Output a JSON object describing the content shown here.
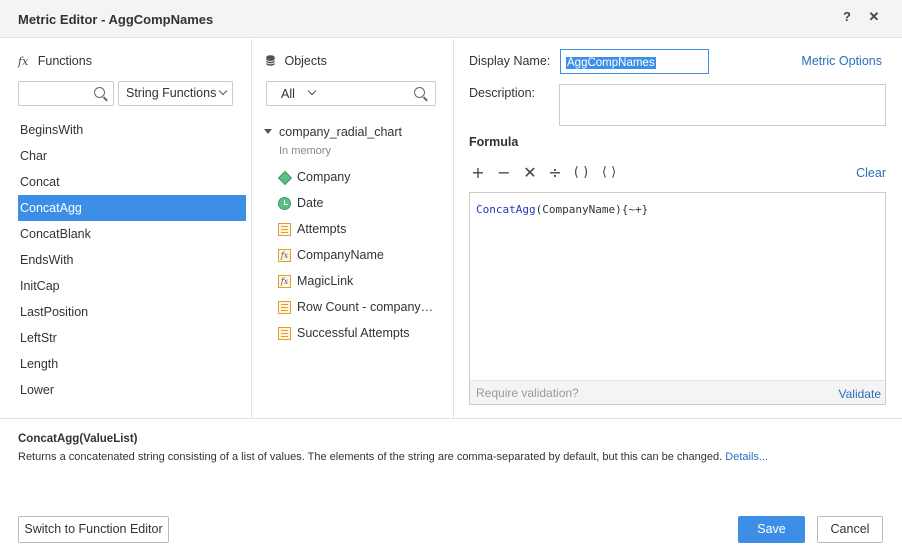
{
  "window": {
    "title": "Metric Editor - AggCompNames",
    "help_label": "?",
    "close_label": "✕"
  },
  "functions_panel": {
    "header": "Functions",
    "header_icon": "fx",
    "search_placeholder": "",
    "category": "String Functions",
    "items": [
      "BeginsWith",
      "Char",
      "Concat",
      "ConcatAgg",
      "ConcatBlank",
      "EndsWith",
      "InitCap",
      "LastPosition",
      "LeftStr",
      "Length",
      "Lower"
    ],
    "selected_index": 3
  },
  "objects_panel": {
    "header": "Objects",
    "filter": "All",
    "root": "company_radial_chart",
    "root_sub": "In memory",
    "items": [
      {
        "label": "Company",
        "icon": "attribute-icon"
      },
      {
        "label": "Date",
        "icon": "date-attribute-icon"
      },
      {
        "label": "Attempts",
        "icon": "measure-icon"
      },
      {
        "label": "CompanyName",
        "icon": "formula-icon"
      },
      {
        "label": "MagicLink",
        "icon": "formula-icon"
      },
      {
        "label": "Row Count - company…",
        "icon": "measure-icon"
      },
      {
        "label": "Successful Attempts",
        "icon": "measure-icon"
      }
    ]
  },
  "editor": {
    "display_name_label": "Display Name:",
    "display_name_value": "AggCompNames",
    "description_label": "Description:",
    "metric_options": "Metric Options",
    "formula_label": "Formula",
    "operators": [
      "+",
      "−",
      "✕",
      "÷",
      "( )",
      "⟨ ⟩"
    ],
    "clear": "Clear",
    "formula_fn": "ConcatAgg",
    "formula_rest": "(CompanyName){~+}",
    "require_validation": "Require validation?",
    "validate": "Validate"
  },
  "help": {
    "signature": "ConcatAgg(ValueList)",
    "description": "Returns a concatenated string consisting of a list of values. The elements of the string are comma-separated by default, but this can be changed.",
    "details": "Details..."
  },
  "footer": {
    "switch": "Switch to Function Editor",
    "save": "Save",
    "cancel": "Cancel"
  },
  "colors": {
    "accent": "#3d8ee6",
    "link": "#2a6fbd",
    "attribute_green": "#5cbf86",
    "measure_orange": "#e0a030"
  }
}
